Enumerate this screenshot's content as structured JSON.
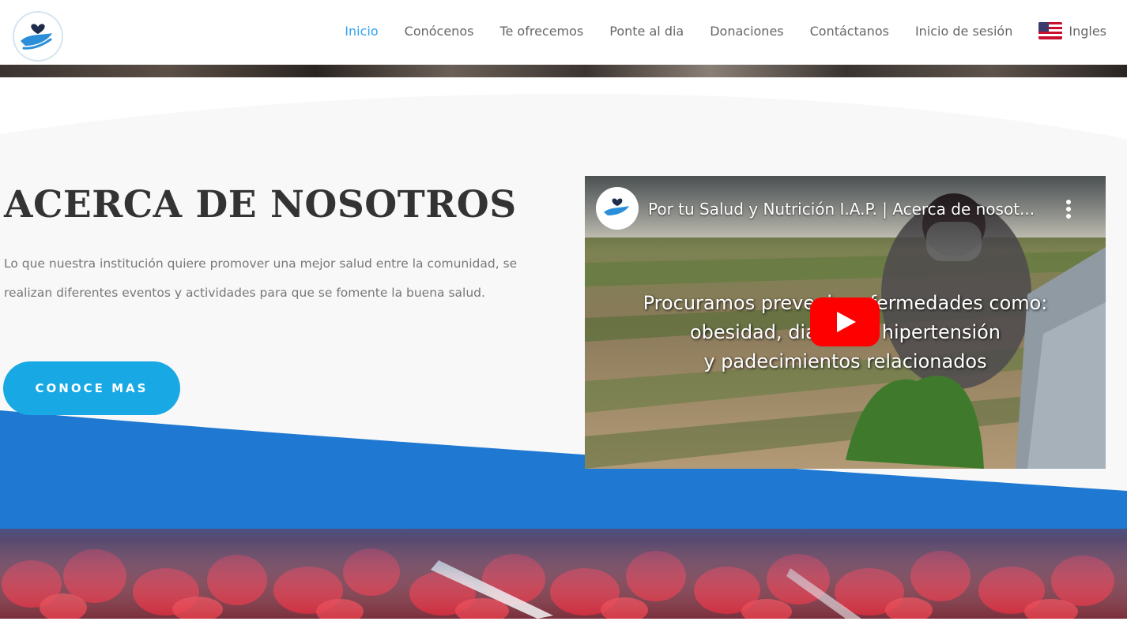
{
  "nav": {
    "items": [
      {
        "label": "Inicio",
        "active": true
      },
      {
        "label": "Conócenos",
        "active": false
      },
      {
        "label": "Te ofrecemos",
        "active": false
      },
      {
        "label": "Ponte al dia",
        "active": false
      },
      {
        "label": "Donaciones",
        "active": false
      },
      {
        "label": "Contáctanos",
        "active": false
      },
      {
        "label": "Inicio de sesión",
        "active": false
      }
    ],
    "language": {
      "label": "Ingles",
      "flag_icon": "us-flag-icon"
    }
  },
  "about": {
    "title": "ACERCA DE NOSOTROS",
    "text": "Lo que nuestra institución quiere promover una mejor salud entre la comunidad, se realizan diferentes eventos y actividades para que se fomente la buena salud.",
    "button_label": "CONOCE MAS"
  },
  "video": {
    "title": "Por tu Salud y Nutrición I.A.P. | Acerca de nosot...",
    "caption_lines": [
      "Procuramos prevenir enfermedades como:",
      "obesidad, diabetes, hipertensión",
      "y padecimientos relacionados"
    ],
    "play_icon": "play-icon",
    "menu_icon": "kebab-menu-icon"
  },
  "colors": {
    "accent": "#2ea3f2",
    "button": "#18a9e4",
    "wave": "#1f78d1",
    "play": "#ff0000",
    "heading": "#333333",
    "body_text": "#777777"
  }
}
